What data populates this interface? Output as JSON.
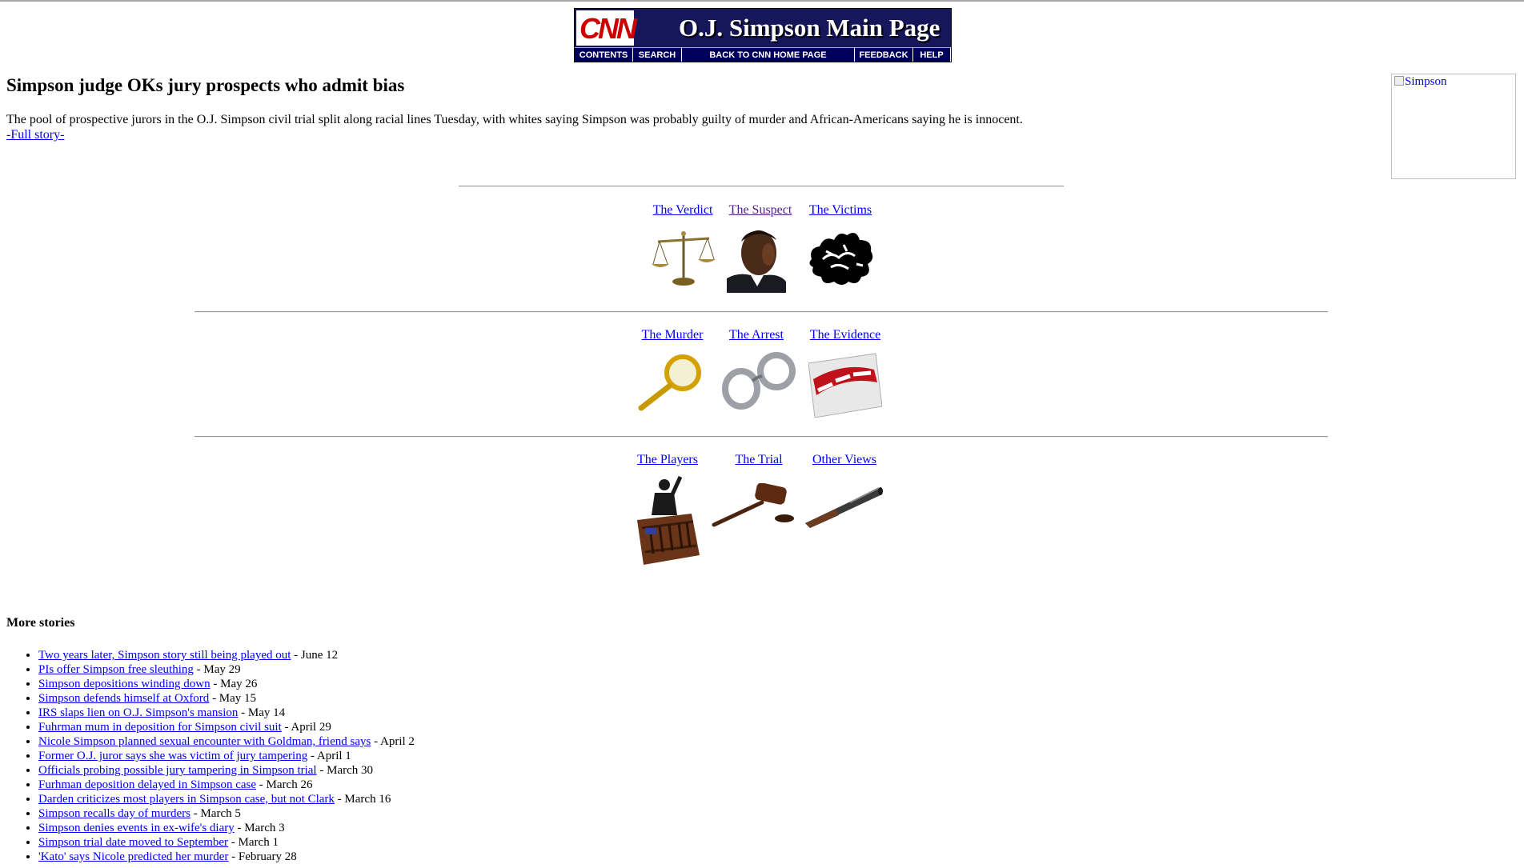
{
  "banner": {
    "logo_text": "CNN",
    "title": "O.J. Simpson Main Page",
    "nav": [
      "CONTENTS",
      "SEARCH",
      "BACK TO CNN HOME PAGE",
      "FEEDBACK",
      "HELP"
    ]
  },
  "headline": {
    "title": "Simpson judge OKs jury prospects who admit bias",
    "lede": "The pool of prospective jurors in the O.J. Simpson civil trial split along racial lines Tuesday, with whites saying Simpson was probably guilty of murder and African-Americans saying he is innocent.",
    "full_story": "-Full story-",
    "side_image_alt": "Simpson"
  },
  "sections": [
    {
      "label": "The Verdict",
      "icon": "scales-icon"
    },
    {
      "label": "The Suspect",
      "icon": "suspect-portrait"
    },
    {
      "label": "The Victims",
      "icon": "victims-icon"
    },
    {
      "label": "The Murder",
      "icon": "magnifier-icon"
    },
    {
      "label": "The Arrest",
      "icon": "handcuffs-icon"
    },
    {
      "label": "The Evidence",
      "icon": "evidence-card-icon"
    },
    {
      "label": "The Players",
      "icon": "witness-stand-icon"
    },
    {
      "label": "The Trial",
      "icon": "gavel-icon"
    },
    {
      "label": "Other Views",
      "icon": "telescope-icon"
    }
  ],
  "more_stories": {
    "title": "More stories",
    "items": [
      {
        "link": "Two years later, Simpson story still being played out",
        "date": " - June 12"
      },
      {
        "link": "PIs offer Simpson free sleuthing",
        "date": " - May 29"
      },
      {
        "link": "Simpson depositions winding down",
        "date": " - May 26"
      },
      {
        "link": "Simpson defends himself at Oxford",
        "date": " - May 15"
      },
      {
        "link": "IRS slaps lien on O.J. Simpson's mansion",
        "date": " - May 14"
      },
      {
        "link": "Fuhrman mum in deposition for Simpson civil suit",
        "date": " - April 29"
      },
      {
        "link": "Nicole Simpson planned sexual encounter with Goldman, friend says",
        "date": " - April 2"
      },
      {
        "link": "Former O.J. juror says she was victim of jury tampering",
        "date": " - April 1"
      },
      {
        "link": "Officials probing possible jury tampering in Simpson trial",
        "date": " - March 30"
      },
      {
        "link": "Furhman deposition delayed in Simpson case",
        "date": " - March 26"
      },
      {
        "link": "Darden criticizes most players in Simpson case, but not Clark",
        "date": " - March 16"
      },
      {
        "link": "Simpson recalls day of murders",
        "date": " - March 5"
      },
      {
        "link": "Simpson denies events in ex-wife's diary",
        "date": " - March 3"
      },
      {
        "link": "Simpson trial date moved to September",
        "date": " - March 1"
      },
      {
        "link": "'Kato' says Nicole predicted her murder",
        "date": " - February 28"
      }
    ]
  }
}
